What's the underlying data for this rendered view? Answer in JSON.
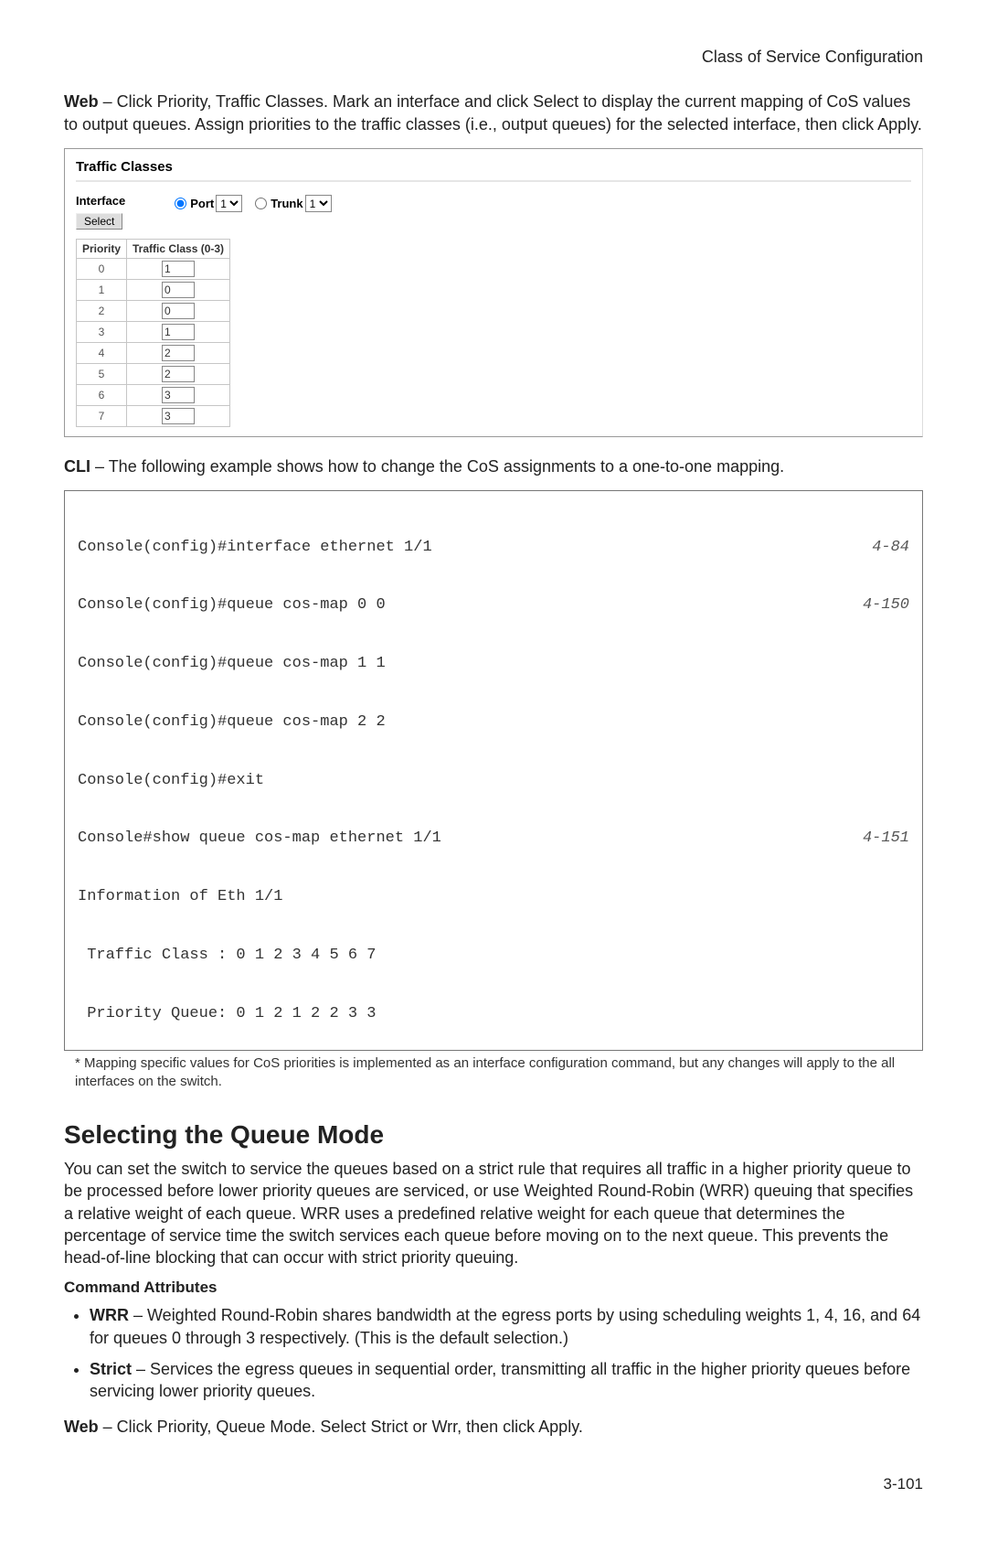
{
  "header": {
    "title": "Class of Service Configuration"
  },
  "intro_web": {
    "label": "Web",
    "text": " – Click Priority, Traffic Classes. Mark an interface and click Select to display the current mapping of CoS values to output queues. Assign priorities to the traffic classes (i.e., output queues) for the selected interface, then click Apply."
  },
  "panel": {
    "title": "Traffic Classes",
    "interface_label": "Interface",
    "select_btn": "Select",
    "port_label": "Port",
    "trunk_label": "Trunk",
    "port_options": [
      "1"
    ],
    "trunk_options": [
      "1"
    ],
    "table_headers": {
      "priority": "Priority",
      "class": "Traffic Class (0-3)"
    },
    "rows": [
      {
        "priority": "0",
        "class": "1"
      },
      {
        "priority": "1",
        "class": "0"
      },
      {
        "priority": "2",
        "class": "0"
      },
      {
        "priority": "3",
        "class": "1"
      },
      {
        "priority": "4",
        "class": "2"
      },
      {
        "priority": "5",
        "class": "2"
      },
      {
        "priority": "6",
        "class": "3"
      },
      {
        "priority": "7",
        "class": "3"
      }
    ]
  },
  "intro_cli": {
    "label": "CLI",
    "text": " – The following example shows how to change the CoS assignments to a one-to-one mapping."
  },
  "cli": {
    "lines": [
      {
        "text": "Console(config)#interface ethernet 1/1",
        "ref": "4-84"
      },
      {
        "text": "Console(config)#queue cos-map 0 0",
        "ref": "4-150"
      },
      {
        "text": "Console(config)#queue cos-map 1 1",
        "ref": ""
      },
      {
        "text": "Console(config)#queue cos-map 2 2",
        "ref": ""
      },
      {
        "text": "Console(config)#exit",
        "ref": ""
      },
      {
        "text": "Console#show queue cos-map ethernet 1/1",
        "ref": "4-151"
      },
      {
        "text": "Information of Eth 1/1",
        "ref": ""
      },
      {
        "text": " Traffic Class : 0 1 2 3 4 5 6 7",
        "ref": ""
      },
      {
        "text": " Priority Queue: 0 1 2 1 2 2 3 3",
        "ref": ""
      }
    ]
  },
  "footnote": "* Mapping specific values for CoS priorities is implemented as an interface configuration command, but any changes will apply to the all interfaces on the switch.",
  "section": {
    "heading": "Selecting the Queue Mode",
    "body": "You can set the switch to service the queues based on a strict rule that requires all traffic in a higher priority queue to be processed before lower priority queues are serviced, or use Weighted Round-Robin (WRR) queuing that specifies a relative weight of each queue. WRR uses a predefined relative weight for each queue that determines the percentage of service time the switch services each queue before moving on to the next queue. This prevents the head-of-line blocking that can occur with strict priority queuing.",
    "cmd_attr_heading": "Command Attributes",
    "attrs": [
      {
        "label": "WRR",
        "text": " – Weighted Round-Robin shares bandwidth at the egress ports by using scheduling weights 1, 4, 16, and 64 for queues 0 through 3 respectively. (This is the default selection.)"
      },
      {
        "label": "Strict",
        "text": " – Services the egress queues in sequential order, transmitting all traffic in the higher priority queues before servicing lower priority queues."
      }
    ],
    "web2_label": "Web",
    "web2_text": " – Click Priority, Queue Mode. Select Strict or Wrr, then click Apply."
  },
  "pagenum": "3-101"
}
